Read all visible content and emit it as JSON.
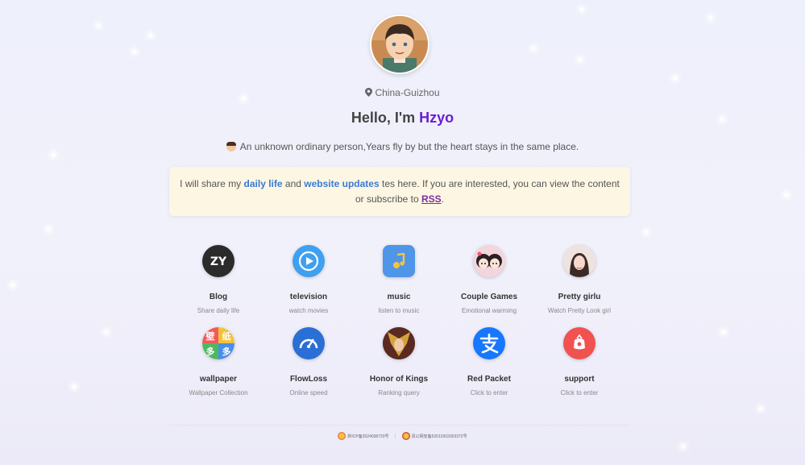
{
  "profile": {
    "location": "China-Guizhou",
    "greeting": "Hello, I'm",
    "name": "Hzyo",
    "bio": "An unknown ordinary person,Years fly by but the heart stays in the same place."
  },
  "notice": {
    "text1": "I will share my",
    "link1": "daily life",
    "text2": "and",
    "link2": "website updates",
    "text3": "tes here. If you are interested, you can view the content or subscribe to",
    "link3": "RSS",
    "text4": "."
  },
  "apps": [
    {
      "title": "Blog",
      "desc": "Share daily life",
      "icon": "zy-logo-icon",
      "color": "#2b2b2b"
    },
    {
      "title": "television",
      "desc": "watch movies",
      "icon": "play-icon",
      "color": "#3fa0f0"
    },
    {
      "title": "music",
      "desc": "listen to music",
      "icon": "music-note-icon",
      "color": "#4f95e8"
    },
    {
      "title": "Couple Games",
      "desc": "Emotional warming",
      "icon": "couple-avatar-icon",
      "color": "#f3d6dc"
    },
    {
      "title": "Pretty girlu",
      "desc": "Watch Pretty Look girl",
      "icon": "girl-avatar-icon",
      "color": "#f0dcd6"
    },
    {
      "title": "wallpaper",
      "desc": "Wallpaper Collection",
      "icon": "wallpaper-icon",
      "color": "#ffffff"
    },
    {
      "title": "FlowLoss",
      "desc": "Online speed",
      "icon": "speedometer-icon",
      "color": "#2a6fd6"
    },
    {
      "title": "Honor of Kings",
      "desc": "Ranking query",
      "icon": "game-hero-icon",
      "color": "#8a3a2a"
    },
    {
      "title": "Red Packet",
      "desc": "Click to enter",
      "icon": "alipay-icon",
      "color": "#1677ff"
    },
    {
      "title": "support",
      "desc": "Click to enter",
      "icon": "red-packet-icon",
      "color": "#f0524f"
    }
  ],
  "wallpaper_chars": [
    "壁",
    "纸",
    "多",
    "多"
  ],
  "footer": {
    "icp": "黔ICP备2024038720号",
    "police": "贵公网安备52010302003372号"
  }
}
